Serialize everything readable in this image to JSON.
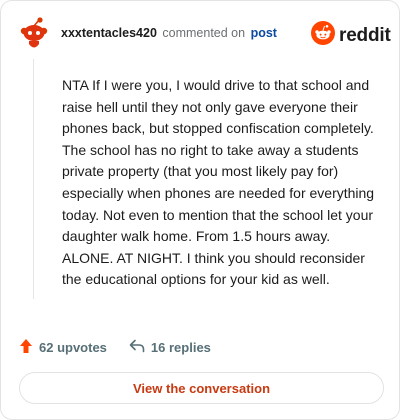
{
  "comment": {
    "author": "xxxtentacles420",
    "action_text": "commented on",
    "post_link_text": "post",
    "body": "NTA If I were you, I would drive to that school and raise hell until they not only gave everyone their phones back, but stopped confiscation completely. The school has no right to take away a students private property (that you most likely pay for) especially when phones are needed for everything today. Not even to mention that the school let your daughter walk home. From 1.5 hours away. ALONE. AT NIGHT. I think you should reconsider the educational options for your kid as well."
  },
  "brand": {
    "name": "reddit",
    "accent_color": "#ff4500"
  },
  "footer": {
    "upvotes_label": "62 upvotes",
    "replies_label": "16 replies"
  },
  "actions": {
    "view_conversation_label": "View the conversation"
  },
  "icons": {
    "avatar": "snoo-avatar-icon",
    "brand_logo": "reddit-logo-icon",
    "upvote": "upvote-arrow-icon",
    "reply": "reply-arrow-icon"
  }
}
